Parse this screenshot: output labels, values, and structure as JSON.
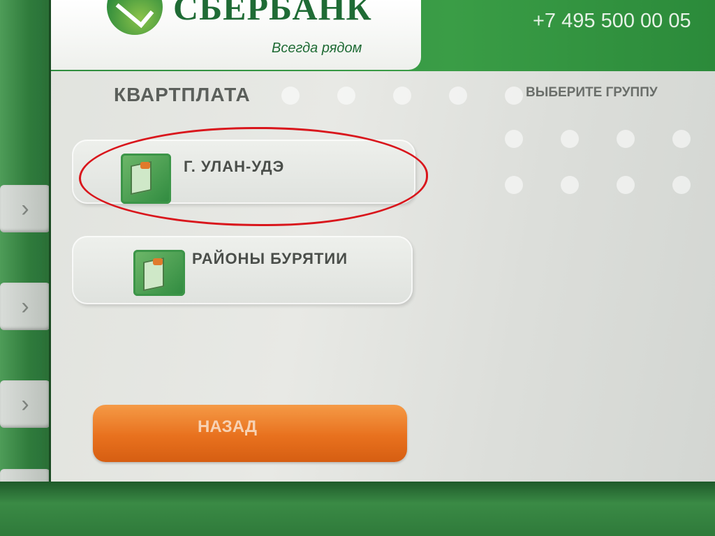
{
  "brand": {
    "name": "СБЕРБАНК",
    "tagline": "Всегда рядом",
    "phone": "+7 495 500 00 05"
  },
  "screen": {
    "title": "КВАРТПЛАТА",
    "hint": "ВЫБЕРИТЕ ГРУППУ"
  },
  "options": [
    {
      "label": "Г. УЛАН-УДЭ",
      "icon": "bill-folder-icon",
      "highlighted": true
    },
    {
      "label": "РАЙОНЫ БУРЯТИИ",
      "icon": "bill-folder-icon",
      "highlighted": false
    }
  ],
  "back_button": {
    "label": "НАЗАД"
  },
  "colors": {
    "brand_green": "#1f6b35",
    "topbar_green": "#3a9d46",
    "back_orange": "#e8711e",
    "annotation_red": "#d9161c"
  }
}
